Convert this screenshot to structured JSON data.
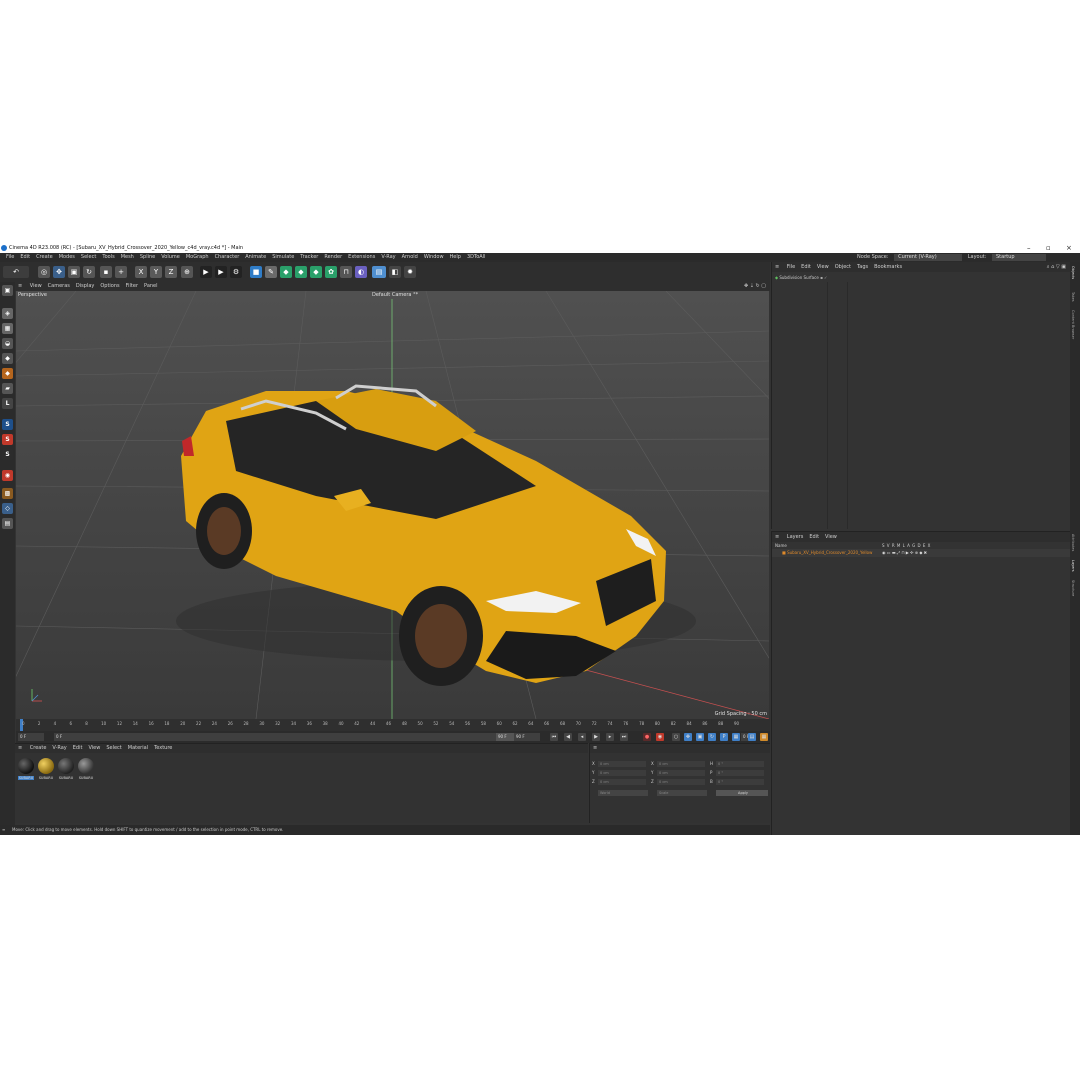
{
  "title": "Cinema 4D R23.008 (RC) - [Subaru_XV_Hybrid_Crossover_2020_Yellow_c4d_vray.c4d *] - Main",
  "menu": [
    "File",
    "Edit",
    "Create",
    "Modes",
    "Select",
    "Tools",
    "Mesh",
    "Spline",
    "Volume",
    "MoGraph",
    "Character",
    "Animate",
    "Simulate",
    "Tracker",
    "Render",
    "Extensions",
    "V-Ray",
    "Arnold",
    "Window",
    "Help",
    "3DToAll"
  ],
  "node_space_label": "Node Space:",
  "node_space_value": "Current (V-Ray)",
  "layout_label": "Layout:",
  "layout_value": "Startup",
  "viewport_menu": [
    "View",
    "Cameras",
    "Display",
    "Options",
    "Filter",
    "Panel"
  ],
  "viewport_label": "Perspective",
  "camera_label": "Default Camera °*",
  "grid_spacing": "Grid Spacing : 50 cm",
  "timeline_ticks": [
    "0",
    "2",
    "4",
    "6",
    "8",
    "10",
    "12",
    "14",
    "16",
    "18",
    "20",
    "22",
    "24",
    "26",
    "28",
    "30",
    "32",
    "34",
    "36",
    "38",
    "40",
    "42",
    "44",
    "46",
    "48",
    "50",
    "52",
    "54",
    "56",
    "58",
    "60",
    "62",
    "64",
    "66",
    "68",
    "70",
    "72",
    "74",
    "76",
    "78",
    "80",
    "82",
    "84",
    "86",
    "88",
    "90"
  ],
  "transport": {
    "start": "0 F",
    "current": "0 F",
    "end": "90 F",
    "end2": "90 F",
    "frame": "0 F"
  },
  "material_menu": [
    "Create",
    "V-Ray",
    "Edit",
    "View",
    "Select",
    "Material",
    "Texture"
  ],
  "materials": [
    {
      "label": "SUBARU",
      "color": "#1a1a1a"
    },
    {
      "label": "SUBARU",
      "color": "#c9a227"
    },
    {
      "label": "SUBARU",
      "color": "#3a3a3a"
    },
    {
      "label": "SUBARU",
      "color": "#555555"
    }
  ],
  "coords": {
    "row_labels": [
      "X",
      "Y",
      "Z"
    ],
    "pos_labels": [
      "X",
      "Y",
      "Z"
    ],
    "size_labels": [
      "H",
      "P",
      "B"
    ],
    "value": "0 cm",
    "angle": "0 °",
    "world": "World",
    "scale": "Scale",
    "apply": "Apply"
  },
  "object_menu": [
    "File",
    "Edit",
    "View",
    "Object",
    "Tags",
    "Bookmarks"
  ],
  "object_item": "Subdivision Surface",
  "layers_menu": [
    "Layers",
    "Edit",
    "View"
  ],
  "layers_header": "Name",
  "layers_cols": "S V R M L A G D E X",
  "layer_item": "Subaru_XV_Hybrid_Crossover_2020_Yellow",
  "side_tabs": [
    "Objects",
    "Takes",
    "Content Browser",
    "Attributes",
    "Layers",
    "Structure"
  ],
  "status": "Move: Click and drag to move elements. Hold down SHIFT to quantize movement / add to the selection in point mode, CTRL to remove."
}
